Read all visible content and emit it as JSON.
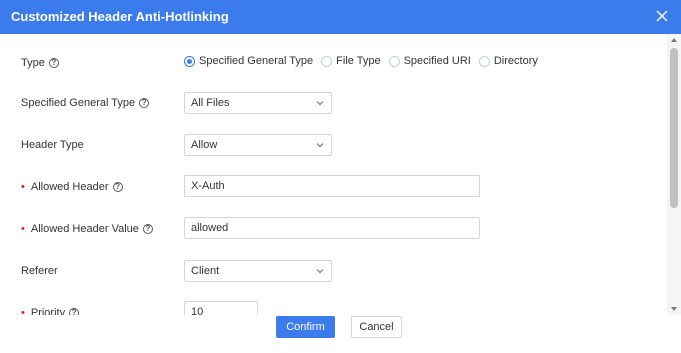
{
  "dialog": {
    "title": "Customized Header Anti-Hotlinking",
    "accent_color": "#3b7bec"
  },
  "form": {
    "type": {
      "label": "Type",
      "options": [
        "Specified General Type",
        "File Type",
        "Specified URI",
        "Directory"
      ],
      "selected": "Specified General Type"
    },
    "specified_general_type": {
      "label": "Specified General Type",
      "value": "All Files"
    },
    "header_type": {
      "label": "Header Type",
      "value": "Allow"
    },
    "allowed_header": {
      "label": "Allowed Header",
      "value": "X-Auth",
      "required": true
    },
    "allowed_header_value": {
      "label": "Allowed Header Value",
      "value": "allowed",
      "required": true
    },
    "referer": {
      "label": "Referer",
      "value": "Client"
    },
    "priority": {
      "label": "Priority",
      "value": "10",
      "required": true
    }
  },
  "footer": {
    "confirm_label": "Confirm",
    "cancel_label": "Cancel"
  },
  "icons": {
    "help": "question-circle-icon",
    "close": "close-icon",
    "dropdown": "chevron-down-icon"
  }
}
